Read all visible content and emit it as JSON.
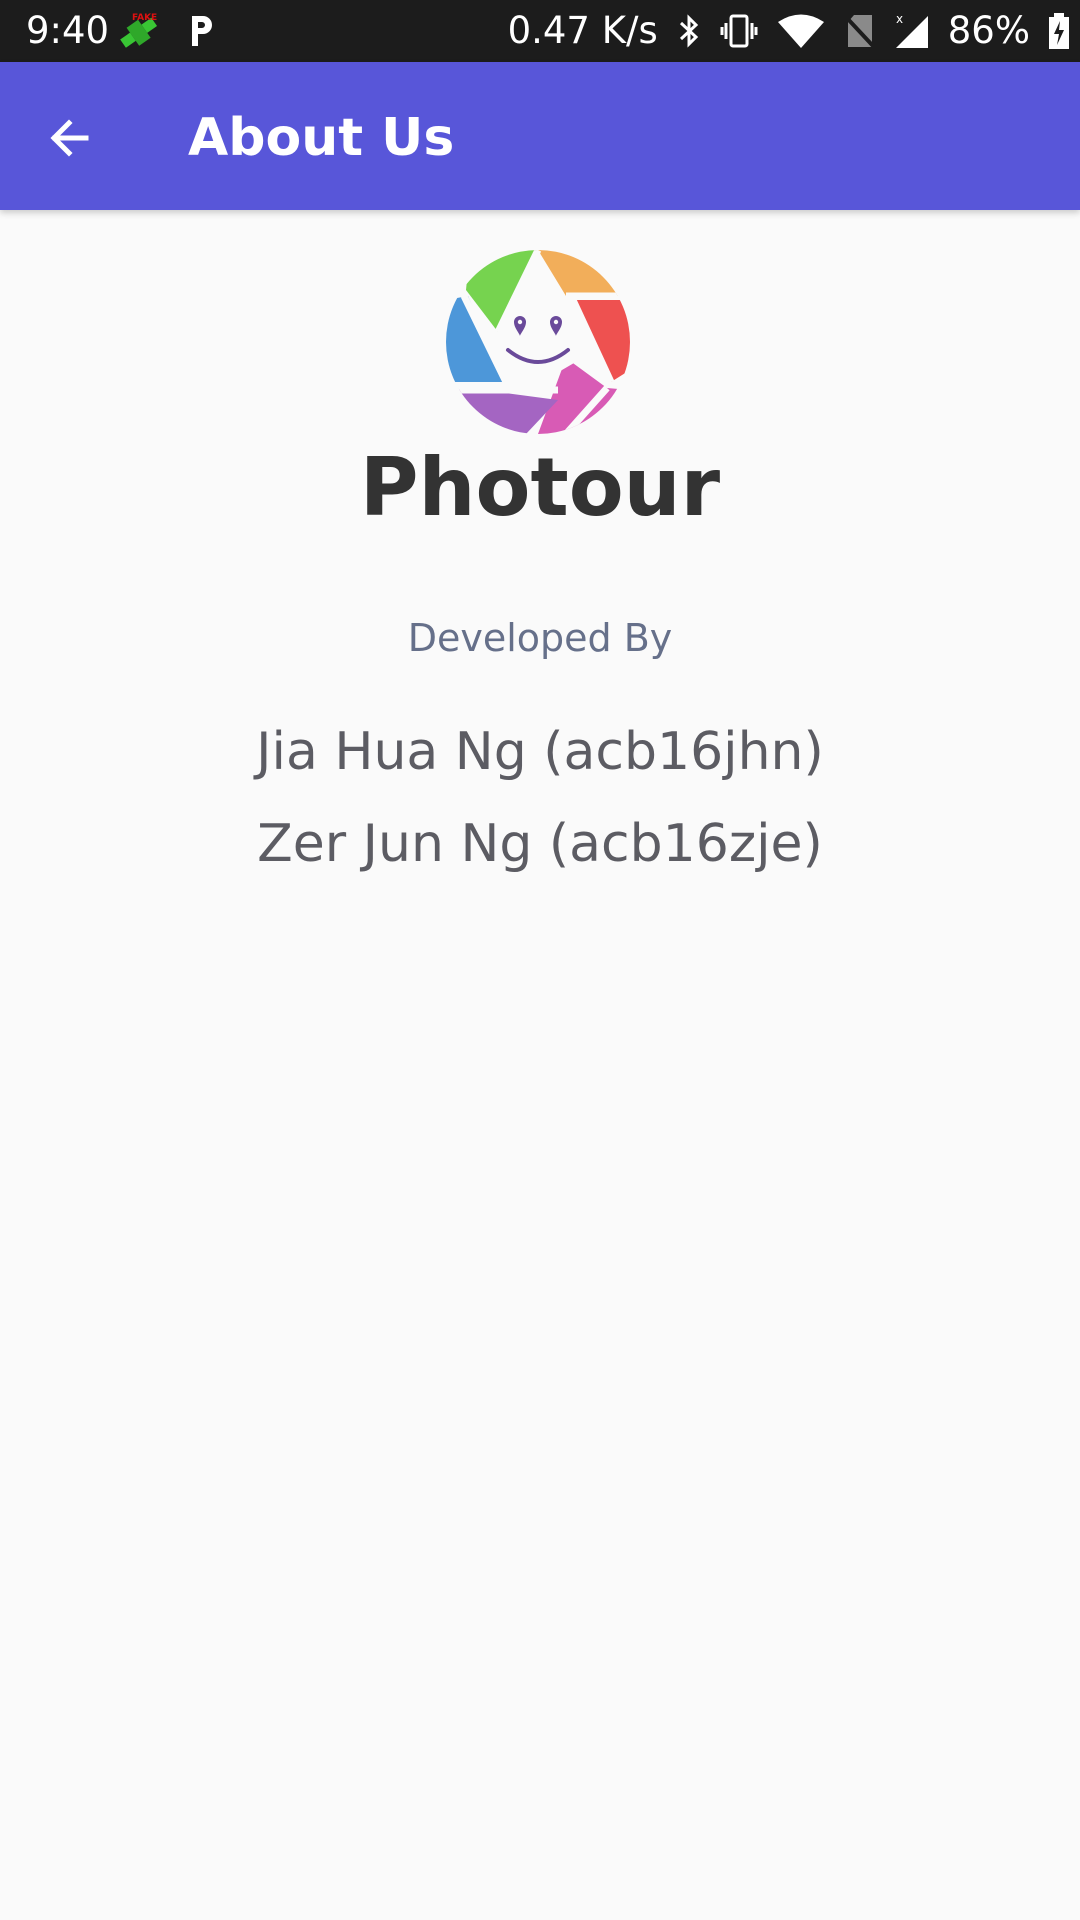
{
  "status_bar": {
    "time": "9:40",
    "left_icons": [
      "fake-gps-icon",
      "parking-p-icon"
    ],
    "network_speed": "0.47 K/s",
    "right_icons": [
      "bluetooth-icon",
      "vibrate-icon",
      "wifi-icon",
      "no-sim-icon",
      "signal-icon",
      "battery-charging-icon"
    ],
    "battery": "86%"
  },
  "app_bar": {
    "back_icon": "arrow-back-icon",
    "title": "About Us",
    "background": "#5856d9"
  },
  "about": {
    "logo_icon": "camera-aperture-smiley-icon",
    "app_name": "Photour",
    "developed_by_label": "Developed By",
    "developers": [
      "Jia Hua Ng (acb16jhn)",
      "Zer Jun Ng (acb16zje)"
    ]
  },
  "colors": {
    "page_background": "#fafafa",
    "app_name_text": "#333333",
    "developed_by_text": "#66708a",
    "developer_text": "#5c5c63"
  }
}
